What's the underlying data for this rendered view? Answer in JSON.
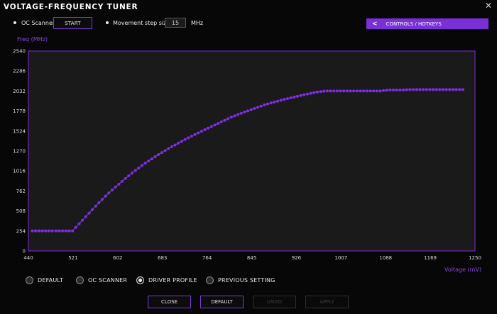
{
  "window": {
    "title": "VOLTAGE-FREQUENCY TUNER",
    "close_symbol": "✕"
  },
  "toolbar": {
    "oc_scanner_label": "OC Scanner",
    "start_label": "START",
    "step_size_label": "Movement step size:",
    "step_size_value": "15",
    "step_unit": "MHz",
    "controls_label": "CONTROLS / HOTKEYS"
  },
  "chart_data": {
    "type": "line",
    "ylabel": "Freq (MHz)",
    "xlabel": "Voltage (mV)",
    "xlim": [
      440,
      1250
    ],
    "ylim": [
      0,
      2540
    ],
    "x_ticks": [
      "440",
      "521",
      "602",
      "683",
      "764",
      "845",
      "926",
      "1007",
      "1088",
      "1169",
      "1250"
    ],
    "y_ticks": [
      "0",
      "254",
      "508",
      "762",
      "1016",
      "1270",
      "1524",
      "1778",
      "2032",
      "2286",
      "2540"
    ],
    "grid": false,
    "series_color": "#7b2fe0",
    "points": [
      [
        447,
        254
      ],
      [
        453,
        254
      ],
      [
        459,
        254
      ],
      [
        465,
        254
      ],
      [
        471,
        254
      ],
      [
        477,
        254
      ],
      [
        483,
        254
      ],
      [
        490,
        254
      ],
      [
        496,
        254
      ],
      [
        502,
        254
      ],
      [
        508,
        254
      ],
      [
        514,
        254
      ],
      [
        520,
        254
      ],
      [
        526,
        300
      ],
      [
        532,
        345
      ],
      [
        538,
        390
      ],
      [
        544,
        435
      ],
      [
        550,
        480
      ],
      [
        556,
        525
      ],
      [
        562,
        570
      ],
      [
        568,
        612
      ],
      [
        574,
        655
      ],
      [
        580,
        697
      ],
      [
        586,
        737
      ],
      [
        592,
        775
      ],
      [
        598,
        812
      ],
      [
        604,
        848
      ],
      [
        610,
        885
      ],
      [
        616,
        920
      ],
      [
        622,
        955
      ],
      [
        628,
        990
      ],
      [
        634,
        1022
      ],
      [
        640,
        1054
      ],
      [
        646,
        1085
      ],
      [
        652,
        1115
      ],
      [
        658,
        1143
      ],
      [
        664,
        1170
      ],
      [
        670,
        1198
      ],
      [
        676,
        1225
      ],
      [
        682,
        1250
      ],
      [
        688,
        1275
      ],
      [
        694,
        1300
      ],
      [
        700,
        1324
      ],
      [
        706,
        1347
      ],
      [
        712,
        1370
      ],
      [
        718,
        1392
      ],
      [
        724,
        1415
      ],
      [
        730,
        1437
      ],
      [
        736,
        1458
      ],
      [
        742,
        1479
      ],
      [
        748,
        1500
      ],
      [
        754,
        1520
      ],
      [
        760,
        1540
      ],
      [
        766,
        1560
      ],
      [
        772,
        1580
      ],
      [
        778,
        1600
      ],
      [
        784,
        1620
      ],
      [
        790,
        1640
      ],
      [
        796,
        1660
      ],
      [
        802,
        1680
      ],
      [
        808,
        1700
      ],
      [
        814,
        1717
      ],
      [
        820,
        1733
      ],
      [
        826,
        1750
      ],
      [
        832,
        1765
      ],
      [
        838,
        1780
      ],
      [
        844,
        1795
      ],
      [
        850,
        1810
      ],
      [
        856,
        1825
      ],
      [
        862,
        1840
      ],
      [
        868,
        1855
      ],
      [
        874,
        1868
      ],
      [
        880,
        1880
      ],
      [
        886,
        1892
      ],
      [
        892,
        1903
      ],
      [
        898,
        1914
      ],
      [
        904,
        1925
      ],
      [
        910,
        1935
      ],
      [
        916,
        1945
      ],
      [
        922,
        1955
      ],
      [
        928,
        1965
      ],
      [
        934,
        1975
      ],
      [
        940,
        1985
      ],
      [
        946,
        1994
      ],
      [
        952,
        2003
      ],
      [
        958,
        2012
      ],
      [
        964,
        2020
      ],
      [
        970,
        2026
      ],
      [
        976,
        2030
      ],
      [
        982,
        2032
      ],
      [
        988,
        2032
      ],
      [
        994,
        2032
      ],
      [
        1000,
        2032
      ],
      [
        1006,
        2032
      ],
      [
        1012,
        2032
      ],
      [
        1018,
        2032
      ],
      [
        1024,
        2032
      ],
      [
        1030,
        2032
      ],
      [
        1036,
        2032
      ],
      [
        1042,
        2032
      ],
      [
        1048,
        2032
      ],
      [
        1054,
        2032
      ],
      [
        1060,
        2032
      ],
      [
        1066,
        2032
      ],
      [
        1072,
        2032
      ],
      [
        1078,
        2032
      ],
      [
        1084,
        2038
      ],
      [
        1090,
        2042
      ],
      [
        1096,
        2045
      ],
      [
        1102,
        2045
      ],
      [
        1108,
        2045
      ],
      [
        1114,
        2045
      ],
      [
        1120,
        2045
      ],
      [
        1126,
        2048
      ],
      [
        1132,
        2050
      ],
      [
        1138,
        2050
      ],
      [
        1144,
        2050
      ],
      [
        1150,
        2050
      ],
      [
        1156,
        2050
      ],
      [
        1162,
        2050
      ],
      [
        1168,
        2050
      ],
      [
        1174,
        2050
      ],
      [
        1180,
        2050
      ],
      [
        1186,
        2050
      ],
      [
        1192,
        2050
      ],
      [
        1198,
        2050
      ],
      [
        1204,
        2050
      ],
      [
        1210,
        2050
      ],
      [
        1216,
        2050
      ],
      [
        1222,
        2050
      ],
      [
        1228,
        2050
      ]
    ]
  },
  "profiles": {
    "options": [
      "DEFAULT",
      "OC SCANNER",
      "DRIVER PROFILE",
      "PREVIOUS SETTING"
    ],
    "selected_index": 2
  },
  "footer": {
    "close_label": "CLOSE",
    "default_label": "DEFAULT",
    "undo_label": "UNDO",
    "apply_label": "APPLY"
  },
  "colors": {
    "accent": "#7b2fd8",
    "background": "#070707",
    "plot_background": "#1a1a1a"
  }
}
